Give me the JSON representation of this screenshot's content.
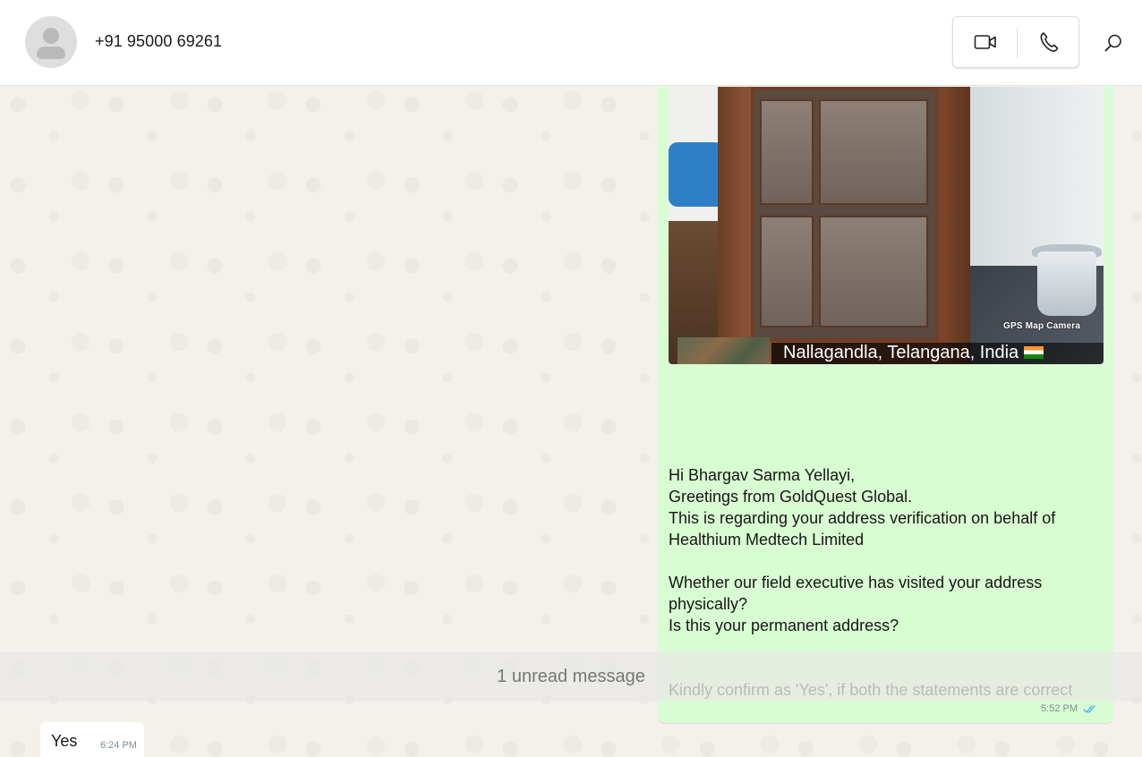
{
  "header": {
    "contact_name": "+91 95000 69261"
  },
  "icons": {
    "avatar": "default-avatar",
    "video": "video-camera-icon",
    "voice": "phone-icon",
    "search": "search-icon"
  },
  "messages": {
    "outgoing": {
      "image": {
        "watermark": "GPS Map Camera",
        "location": "Nallagandla, Telangana, India"
      },
      "lines": [
        "Hi Bhargav Sarma Yellayi,",
        "Greetings from GoldQuest Global.",
        "This is regarding your address verification on behalf of",
        "Healthium Medtech Limited",
        "",
        "Whether our field executive has visited your address",
        "physically?",
        "Is this your permanent address?",
        "",
        "",
        "Kindly confirm as 'Yes', if both the statements are correct"
      ],
      "time": "5:52 PM"
    },
    "unread_label": "1 unread message",
    "incoming": {
      "text": "Yes",
      "time": "6:24 PM"
    }
  },
  "colors": {
    "outgoing_bubble": "#d9fdd3",
    "read_ticks": "#53bdeb"
  }
}
